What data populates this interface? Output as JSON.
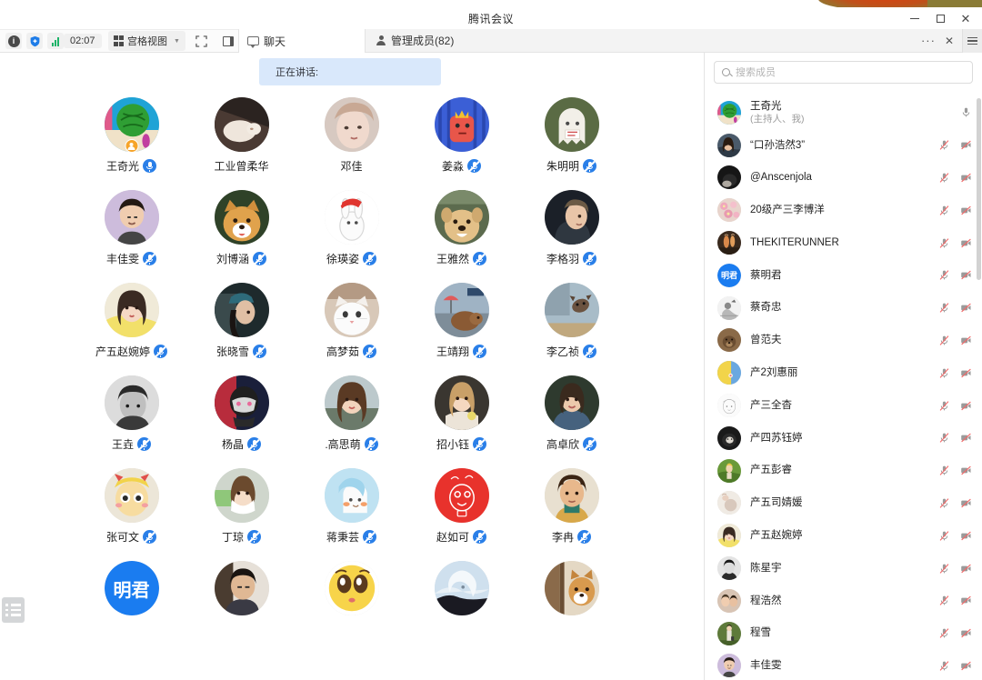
{
  "window": {
    "title": "腾讯会议",
    "minimize_label": "最小化",
    "maximize_label": "最大化",
    "close_label": "关闭"
  },
  "toolbar": {
    "info_icon": "info-icon",
    "shield_icon": "shield-icon",
    "signal_icon": "signal-icon",
    "timer": "02:07",
    "view_mode": "宫格视图",
    "fullscreen_icon": "fullscreen-icon",
    "side_panel_icon": "side-panel-icon"
  },
  "panel_tabs": {
    "chat_label": "聊天",
    "members_label": "管理成员(82)",
    "more_label": "···",
    "close_label": "✕",
    "menu_label": "菜单"
  },
  "search": {
    "placeholder": "搜索成员",
    "value": ""
  },
  "stage": {
    "speaking_banner": "正在讲话:",
    "grid": [
      {
        "name": "王奇光",
        "host": true,
        "mic": "on",
        "avatar": "watermelon"
      },
      {
        "name": "工业曾柔华",
        "host": false,
        "mic": "none",
        "avatar": "cat-sofa"
      },
      {
        "name": "邓佳",
        "host": false,
        "mic": "none",
        "avatar": "girl-portrait"
      },
      {
        "name": "姜淼",
        "host": false,
        "mic": "muted",
        "avatar": "tiger-cartoon"
      },
      {
        "name": "朱明明",
        "host": false,
        "mic": "muted",
        "avatar": "ghost"
      },
      {
        "name": "丰佳雯",
        "host": false,
        "mic": "muted",
        "avatar": "man-purple"
      },
      {
        "name": "刘博涵",
        "host": false,
        "mic": "muted",
        "avatar": "shiba-dog"
      },
      {
        "name": "徐瑛姿",
        "host": false,
        "mic": "muted",
        "avatar": "rabbit-santa"
      },
      {
        "name": "王雅然",
        "host": false,
        "mic": "muted",
        "avatar": "chow-dog"
      },
      {
        "name": "李格羽",
        "host": false,
        "mic": "muted",
        "avatar": "woman-hood"
      },
      {
        "name": "产五赵婉婷",
        "host": false,
        "mic": "muted",
        "avatar": "girl-yellow"
      },
      {
        "name": "张晓雪",
        "host": false,
        "mic": "muted",
        "avatar": "girl-cap"
      },
      {
        "name": "高梦茹",
        "host": false,
        "mic": "muted",
        "avatar": "white-cat"
      },
      {
        "name": "王靖翔",
        "host": false,
        "mic": "muted",
        "avatar": "dog-umbrella"
      },
      {
        "name": "李乙祯",
        "host": false,
        "mic": "muted",
        "avatar": "cat-wall"
      },
      {
        "name": "王垚",
        "host": false,
        "mic": "muted",
        "avatar": "bw-portrait"
      },
      {
        "name": "杨晶",
        "host": false,
        "mic": "muted",
        "avatar": "helmet-cartoon"
      },
      {
        "name": ".高思萌",
        "host": false,
        "mic": "muted",
        "avatar": "girl-pose"
      },
      {
        "name": "招小钰",
        "host": false,
        "mic": "muted",
        "avatar": "girl-drink"
      },
      {
        "name": "高卓欣",
        "host": false,
        "mic": "muted",
        "avatar": "girl-denim"
      },
      {
        "name": "张可文",
        "host": false,
        "mic": "muted",
        "avatar": "star-cartoon"
      },
      {
        "name": "丁琼",
        "host": false,
        "mic": "muted",
        "avatar": "girl-mask"
      },
      {
        "name": "蒋秉芸",
        "host": false,
        "mic": "muted",
        "avatar": "blue-doll"
      },
      {
        "name": "赵如可",
        "host": false,
        "mic": "muted",
        "avatar": "red-doodle"
      },
      {
        "name": "李冉",
        "host": false,
        "mic": "muted",
        "avatar": "boy-curly"
      },
      {
        "name": "",
        "host": false,
        "mic": "none",
        "avatar": "mingjun-initials",
        "initials": "明君"
      },
      {
        "name": "",
        "host": false,
        "mic": "none",
        "avatar": "man-dark"
      },
      {
        "name": "",
        "host": false,
        "mic": "none",
        "avatar": "emoji-eyes"
      },
      {
        "name": "",
        "host": false,
        "mic": "none",
        "avatar": "white-hair-anime"
      },
      {
        "name": "",
        "host": false,
        "mic": "none",
        "avatar": "shiba-door"
      }
    ]
  },
  "members": {
    "list": [
      {
        "name": "王奇光",
        "sub": "(主持人、我)",
        "mic": "on",
        "cam": "none",
        "avatar": "watermelon"
      },
      {
        "name": "“口孙浩然3”",
        "sub": "",
        "mic": "muted",
        "cam": "muted",
        "avatar": "girl-selfie"
      },
      {
        "name": "@Anscenjola",
        "sub": "",
        "mic": "muted",
        "cam": "muted",
        "avatar": "dark-photo"
      },
      {
        "name": "20级产三李博洋",
        "sub": "",
        "mic": "muted",
        "cam": "muted",
        "avatar": "flowers"
      },
      {
        "name": "THEKITERUNNER",
        "sub": "",
        "mic": "muted",
        "cam": "muted",
        "avatar": "kite-runner"
      },
      {
        "name": "蔡明君",
        "sub": "",
        "mic": "muted",
        "cam": "muted",
        "avatar": "mingjun-initials",
        "initials": "明君"
      },
      {
        "name": "蔡奇忠",
        "sub": "",
        "mic": "muted",
        "cam": "muted",
        "avatar": "grey-sketch"
      },
      {
        "name": "曾范夫",
        "sub": "",
        "mic": "muted",
        "cam": "muted",
        "avatar": "brown-animal"
      },
      {
        "name": "产2刘惠丽",
        "sub": "",
        "mic": "muted",
        "cam": "muted",
        "avatar": "yellow-blue"
      },
      {
        "name": "产三全杳",
        "sub": "",
        "mic": "muted",
        "cam": "muted",
        "avatar": "line-face"
      },
      {
        "name": "产四苏钰婷",
        "sub": "",
        "mic": "muted",
        "cam": "muted",
        "avatar": "dark-cat"
      },
      {
        "name": "产五彭睿",
        "sub": "",
        "mic": "muted",
        "cam": "muted",
        "avatar": "green-grass"
      },
      {
        "name": "产五司婧媛",
        "sub": "",
        "mic": "muted",
        "cam": "muted",
        "avatar": "light-photo"
      },
      {
        "name": "产五赵婉婷",
        "sub": "",
        "mic": "muted",
        "cam": "muted",
        "avatar": "girl-yellow"
      },
      {
        "name": "陈星宇",
        "sub": "",
        "mic": "muted",
        "cam": "muted",
        "avatar": "bw-person"
      },
      {
        "name": "程浩然",
        "sub": "",
        "mic": "muted",
        "cam": "muted",
        "avatar": "couple"
      },
      {
        "name": "程雪",
        "sub": "",
        "mic": "muted",
        "cam": "muted",
        "avatar": "green-field"
      },
      {
        "name": "丰佳雯",
        "sub": "",
        "mic": "muted",
        "cam": "muted",
        "avatar": "man-purple"
      }
    ]
  },
  "left_handle": {
    "label": "list-handle"
  },
  "colors": {
    "accent": "#2a7fe8",
    "banner_bg": "#d9e8fb",
    "mute_red": "#f05a5a",
    "host_orange": "#f6a429",
    "signal_green": "#1cb368"
  }
}
